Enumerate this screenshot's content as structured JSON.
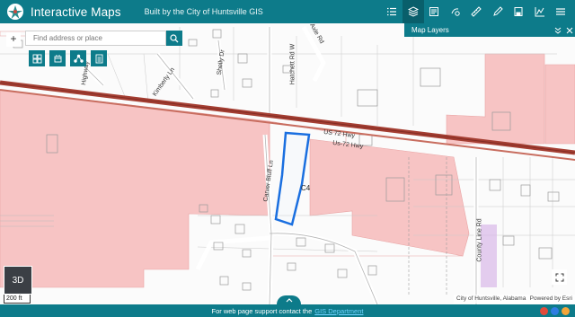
{
  "header": {
    "title": "Interactive Maps",
    "subtitle": "Built by the City of Huntsville GIS",
    "tools": [
      {
        "name": "list-icon"
      },
      {
        "name": "layers-icon",
        "active": true
      },
      {
        "name": "legend-icon"
      },
      {
        "name": "basemap-gallery-icon"
      },
      {
        "name": "measure-icon"
      },
      {
        "name": "draw-icon"
      },
      {
        "name": "print-icon"
      },
      {
        "name": "chart-icon"
      },
      {
        "name": "menu-icon"
      }
    ]
  },
  "layers_panel": {
    "title": "Map Layers",
    "collapse_label": "⌄⌄",
    "close_label": "✕"
  },
  "search": {
    "zoom_in": "+",
    "placeholder": "Find address or place"
  },
  "map": {
    "labels": {
      "us72_a": "US 72 Hwy",
      "us72_b": "Us-72 Hwy",
      "highway": "Highway",
      "kimberly": "Kimberly Ln",
      "shelly": "Shelly Dr",
      "hatchett": "Hatchett Rd W",
      "axle": "Axle Rd",
      "carver": "Carver Bluff Ln",
      "county_line": "County Line Rd",
      "c4": "C4"
    },
    "colors": {
      "zone": "#f7c4c4",
      "highway": "#a43e32",
      "selection": "#1a6fe0",
      "accent": "#0d7b8a"
    }
  },
  "basemap": {
    "label": "3D"
  },
  "scale": {
    "label": "200 ft"
  },
  "attribution": {
    "source": "City of Huntsville, Alabama",
    "powered": "Powered by Esri"
  },
  "footer": {
    "text": "For web page support contact the",
    "link": "GIS Department"
  }
}
